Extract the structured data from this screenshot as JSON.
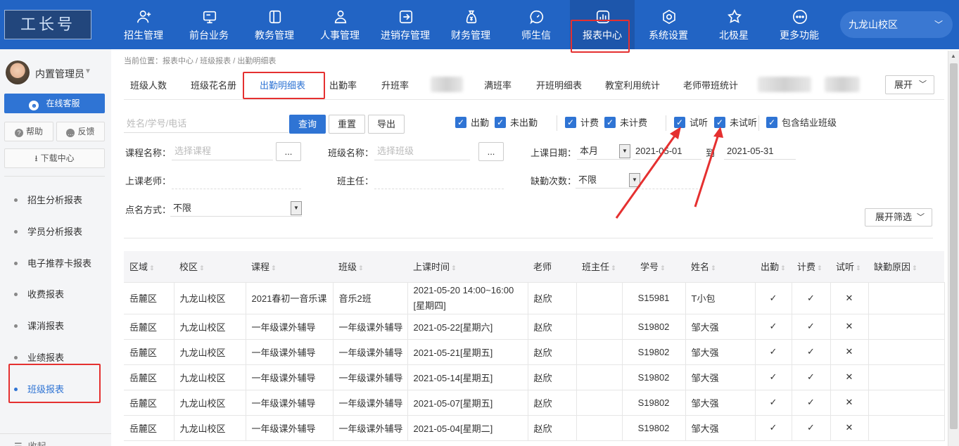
{
  "colors": {
    "header": "#2264c4",
    "accent": "#2f74d4",
    "highlight": "#e53030"
  },
  "logo": {
    "text": "工长号"
  },
  "nav": [
    {
      "label": "招生管理",
      "icon": "person-add-icon"
    },
    {
      "label": "前台业务",
      "icon": "monitor-icon"
    },
    {
      "label": "教务管理",
      "icon": "book-icon"
    },
    {
      "label": "人事管理",
      "icon": "person-icon"
    },
    {
      "label": "进销存管理",
      "icon": "exchange-icon"
    },
    {
      "label": "财务管理",
      "icon": "money-bag-icon"
    },
    {
      "label": "师生信",
      "icon": "chat-icon"
    },
    {
      "label": "报表中心",
      "icon": "chart-icon"
    },
    {
      "label": "系统设置",
      "icon": "settings-icon"
    },
    {
      "label": "北极星",
      "icon": "star-icon"
    },
    {
      "label": "更多功能",
      "icon": "more-icon"
    }
  ],
  "campus": {
    "label": "九龙山校区"
  },
  "user": {
    "name": "内置管理员"
  },
  "sidebar": {
    "service": "在线客服",
    "help": "帮助",
    "feedback": "反馈",
    "download": "下载中心",
    "items": [
      "招生分析报表",
      "学员分析报表",
      "电子推荐卡报表",
      "收费报表",
      "课消报表",
      "业绩报表",
      "班级报表"
    ],
    "collapse": "收起"
  },
  "breadcrumb": "当前位置：报表中心 / 班级报表 / 出勤明细表",
  "tabs": [
    "班级人数",
    "班级花名册",
    "出勤明细表",
    "出勤率",
    "升班率",
    "满班率",
    "开班明细表",
    "教室利用统计",
    "老师带班统计"
  ],
  "tab_expand": "展开",
  "filters": {
    "search_placeholder": "姓名/学号/电话",
    "query": "查询",
    "reset": "重置",
    "export": "导出",
    "checkboxes": [
      "出勤",
      "未出勤",
      "计费",
      "未计费",
      "试听",
      "未试听",
      "包含结业班级"
    ],
    "course_label": "课程名称：",
    "course_placeholder": "选择课程",
    "class_label": "班级名称：",
    "class_placeholder": "选择班级",
    "pick": "...",
    "date_label": "上课日期：",
    "date_mode": "本月",
    "date_from": "2021-05-01",
    "date_to_label": "到",
    "date_to": "2021-05-31",
    "teacher_label": "上课老师：",
    "head_label": "班主任：",
    "absence_label": "缺勤次数：",
    "absence_value": "不限",
    "rollcall_label": "点名方式：",
    "rollcall_value": "不限",
    "expand": "展开筛选"
  },
  "table": {
    "headers": [
      "区域",
      "校区",
      "课程",
      "班级",
      "上课时间",
      "老师",
      "班主任",
      "学号",
      "姓名",
      "出勤",
      "计费",
      "试听",
      "缺勤原因"
    ],
    "rows": [
      [
        "岳麓区",
        "九龙山校区",
        "2021春初一音乐课",
        "音乐2班",
        "2021-05-20 14:00~16:00 [星期四]",
        "赵欣",
        "",
        "S15981",
        "T小包",
        "✓",
        "✓",
        "✕",
        ""
      ],
      [
        "岳麓区",
        "九龙山校区",
        "一年级课外辅导",
        "一年级课外辅导",
        "2021-05-22[星期六]",
        "赵欣",
        "",
        "S19802",
        "邹大强",
        "✓",
        "✓",
        "✕",
        ""
      ],
      [
        "岳麓区",
        "九龙山校区",
        "一年级课外辅导",
        "一年级课外辅导",
        "2021-05-21[星期五]",
        "赵欣",
        "",
        "S19802",
        "邹大强",
        "✓",
        "✓",
        "✕",
        ""
      ],
      [
        "岳麓区",
        "九龙山校区",
        "一年级课外辅导",
        "一年级课外辅导",
        "2021-05-14[星期五]",
        "赵欣",
        "",
        "S19802",
        "邹大强",
        "✓",
        "✓",
        "✕",
        ""
      ],
      [
        "岳麓区",
        "九龙山校区",
        "一年级课外辅导",
        "一年级课外辅导",
        "2021-05-07[星期五]",
        "赵欣",
        "",
        "S19802",
        "邹大强",
        "✓",
        "✓",
        "✕",
        ""
      ],
      [
        "岳麓区",
        "九龙山校区",
        "一年级课外辅导",
        "一年级课外辅导",
        "2021-05-04[星期二]",
        "赵欣",
        "",
        "S19802",
        "邹大强",
        "✓",
        "✓",
        "✕",
        ""
      ]
    ]
  }
}
